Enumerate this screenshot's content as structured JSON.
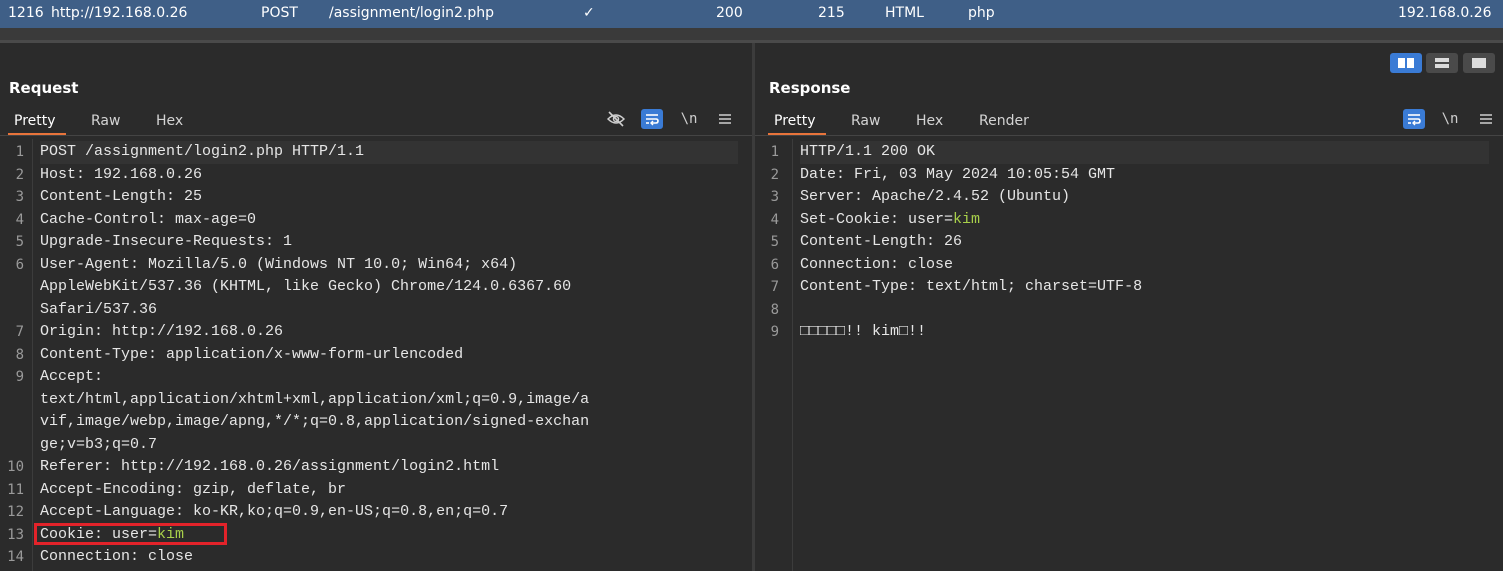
{
  "history": {
    "id": "1216",
    "host": "http://192.168.0.26",
    "method": "POST",
    "url": "/assignment/login2.php",
    "edited": "✓",
    "status": "200",
    "length": "215",
    "mime": "HTML",
    "extension": "php",
    "ip": "192.168.0.26"
  },
  "request": {
    "title": "Request",
    "tabs": [
      "Pretty",
      "Raw",
      "Hex"
    ],
    "line_numbers": [
      "1",
      "2",
      "3",
      "4",
      "5",
      "6",
      "",
      "",
      "7",
      "8",
      "9",
      "",
      "",
      "",
      "10",
      "11",
      "12",
      "13",
      "14"
    ],
    "lines": [
      {
        "k": "POST /assignment/login2.php HTTP/1.1",
        "v": ""
      },
      {
        "k": "Host: ",
        "v": "192.168.0.26"
      },
      {
        "k": "Content-Length: ",
        "v": "25"
      },
      {
        "k": "Cache-Control: ",
        "v": "max-age=0"
      },
      {
        "k": "Upgrade-Insecure-Requests: ",
        "v": "1"
      },
      {
        "k": "User-Agent: ",
        "v": "Mozilla/5.0 (Windows NT 10.0; Win64; x64)"
      },
      {
        "k": "",
        "v": "AppleWebKit/537.36 (KHTML, like Gecko) Chrome/124.0.6367.60"
      },
      {
        "k": "",
        "v": "Safari/537.36"
      },
      {
        "k": "Origin: ",
        "v": "http://192.168.0.26"
      },
      {
        "k": "Content-Type: ",
        "v": "application/x-www-form-urlencoded"
      },
      {
        "k": "Accept: ",
        "v": ""
      },
      {
        "k": "",
        "v": "text/html,application/xhtml+xml,application/xml;q=0.9,image/a"
      },
      {
        "k": "",
        "v": "vif,image/webp,image/apng,*/*;q=0.8,application/signed-exchan"
      },
      {
        "k": "",
        "v": "ge;v=b3;q=0.7"
      },
      {
        "k": "Referer: ",
        "v": "http://192.168.0.26/assignment/login2.html"
      },
      {
        "k": "Accept-Encoding: ",
        "v": "gzip, deflate, br"
      },
      {
        "k": "Accept-Language: ",
        "v": "ko-KR,ko;q=0.9,en-US;q=0.8,en;q=0.7"
      },
      {
        "k": "Cookie: ",
        "v": "user=",
        "g": "kim"
      },
      {
        "k": "Connection: ",
        "v": "close"
      }
    ]
  },
  "response": {
    "title": "Response",
    "tabs": [
      "Pretty",
      "Raw",
      "Hex",
      "Render"
    ],
    "line_numbers": [
      "1",
      "2",
      "3",
      "4",
      "5",
      "6",
      "7",
      "8",
      "9"
    ],
    "lines": [
      {
        "k": "HTTP/1.1 200 OK",
        "v": ""
      },
      {
        "k": "Date: ",
        "v": "Fri, 03 May 2024 10:05:54 GMT"
      },
      {
        "k": "Server: ",
        "v": "Apache/2.4.52 (Ubuntu)"
      },
      {
        "k": "Set-Cookie: ",
        "v": "user=",
        "g": "kim"
      },
      {
        "k": "Content-Length: ",
        "v": "26"
      },
      {
        "k": "Connection: ",
        "v": "close"
      },
      {
        "k": "Content-Type: ",
        "v": "text/html; charset=UTF-8"
      },
      {
        "k": "",
        "v": ""
      },
      {
        "k": "",
        "v": "□□□□□!! kim□!!"
      }
    ]
  },
  "colors": {
    "accent": "#e8743b",
    "toggle_on": "#3a7bd5",
    "value_green": "#a8d04a",
    "highlight_box": "#e3232a"
  },
  "icons": {
    "hide": "eye-slash-icon",
    "wrap": "wrap-lines-icon",
    "newline": "newline-icon",
    "menu": "menu-icon"
  }
}
